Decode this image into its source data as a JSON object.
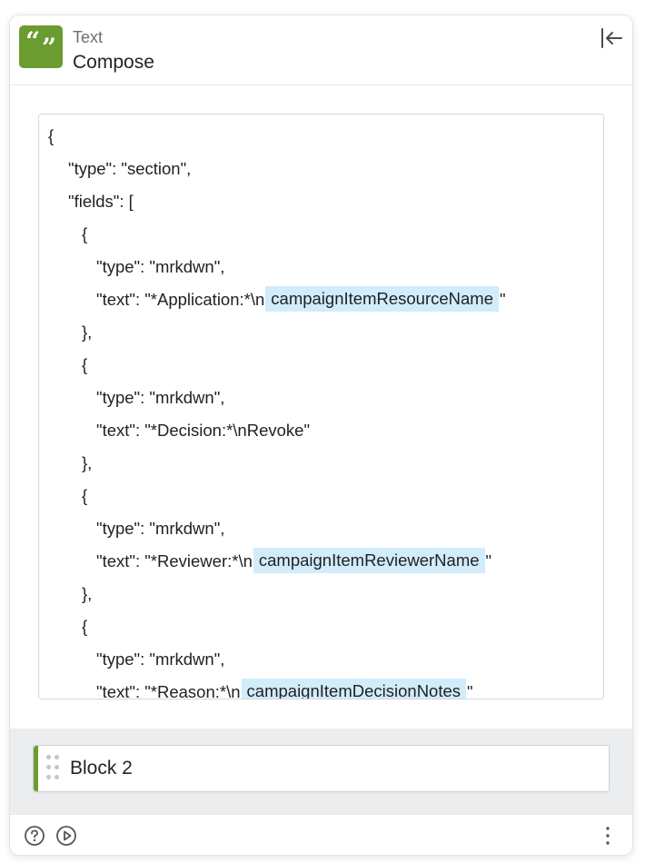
{
  "header": {
    "app_name": "Text",
    "action_name": "Compose",
    "app_icon": "quote-icon",
    "collapse_icon": "collapse-left-icon",
    "accent_color": "#6a9c2f"
  },
  "editor": {
    "pill_color": "#d1ecfb",
    "lines": [
      {
        "indent": 0,
        "text": "{",
        "pill": "",
        "suffix": ""
      },
      {
        "indent": 1,
        "text": "\"type\": \"section\",",
        "pill": "",
        "suffix": ""
      },
      {
        "indent": 1,
        "text": "\"fields\": [",
        "pill": "",
        "suffix": ""
      },
      {
        "indent": 2,
        "text": "{",
        "pill": "",
        "suffix": ""
      },
      {
        "indent": 3,
        "text": "\"type\": \"mrkdwn\",",
        "pill": "",
        "suffix": ""
      },
      {
        "indent": 3,
        "text": "\"text\": \"*Application:*\\n",
        "pill": "campaignItemResourceName",
        "suffix": "\""
      },
      {
        "indent": 2,
        "text": "},",
        "pill": "",
        "suffix": ""
      },
      {
        "indent": 2,
        "text": "{",
        "pill": "",
        "suffix": ""
      },
      {
        "indent": 3,
        "text": "\"type\": \"mrkdwn\",",
        "pill": "",
        "suffix": ""
      },
      {
        "indent": 3,
        "text": "\"text\": \"*Decision:*\\nRevoke\"",
        "pill": "",
        "suffix": ""
      },
      {
        "indent": 2,
        "text": "},",
        "pill": "",
        "suffix": ""
      },
      {
        "indent": 2,
        "text": "{",
        "pill": "",
        "suffix": ""
      },
      {
        "indent": 3,
        "text": "\"type\": \"mrkdwn\",",
        "pill": "",
        "suffix": ""
      },
      {
        "indent": 3,
        "text": "\"text\": \"*Reviewer:*\\n",
        "pill": "campaignItemReviewerName",
        "suffix": "\""
      },
      {
        "indent": 2,
        "text": "},",
        "pill": "",
        "suffix": ""
      },
      {
        "indent": 2,
        "text": "{",
        "pill": "",
        "suffix": ""
      },
      {
        "indent": 3,
        "text": "\"type\": \"mrkdwn\",",
        "pill": "",
        "suffix": ""
      },
      {
        "indent": 3,
        "text": "\"text\": \"*Reason:*\\n",
        "pill": "campaignItemDecisionNotes",
        "suffix": "\""
      }
    ]
  },
  "blocks": [
    {
      "label": "Block 2",
      "handle_icon": "drag-handle-icon"
    }
  ],
  "footer": {
    "help_icon": "help-circle-icon",
    "play_icon": "play-circle-icon",
    "more_icon": "more-vertical-icon"
  }
}
